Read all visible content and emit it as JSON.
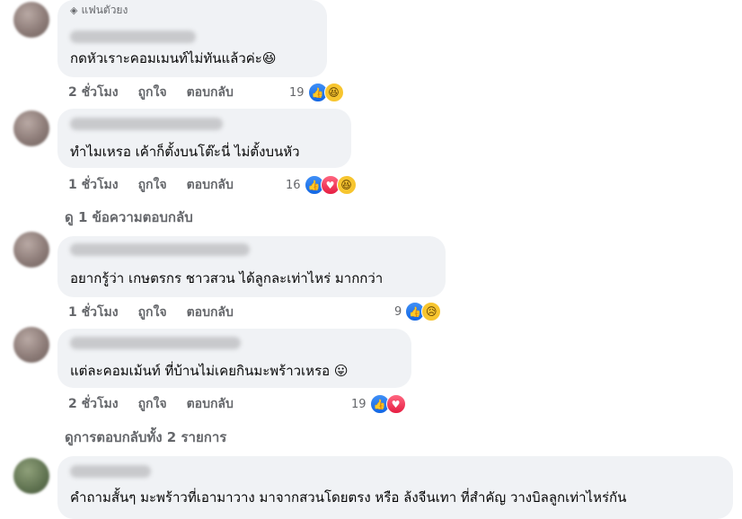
{
  "badge_label": "แฟนตัวยง",
  "comments": [
    {
      "text": "กดหัวเราะคอมเมนท์ไม่ทันแล้วค่ะ",
      "text_emoji": "😆",
      "time": "2 ชั่วโมง",
      "like_label": "ถูกใจ",
      "reply_label": "ตอบกลับ",
      "reaction_count": "19",
      "reactions": [
        "like-icon",
        "haha-icon"
      ]
    },
    {
      "text": "ทำไมเหรอ เค้าก็ตั้งบนโต๊ะนี่ ไม่ตั้งบนหัว",
      "text_emoji": "",
      "time": "1 ชั่วโมง",
      "like_label": "ถูกใจ",
      "reply_label": "ตอบกลับ",
      "reaction_count": "16",
      "reactions": [
        "like-icon",
        "love-icon",
        "haha-icon"
      ]
    },
    {
      "text": "อยากรู้ว่า เกษตรกร ชาวสวน ได้ลูกละเท่าไหร่ มากกว่า",
      "text_emoji": "",
      "time": "1 ชั่วโมง",
      "like_label": "ถูกใจ",
      "reply_label": "ตอบกลับ",
      "reaction_count": "9",
      "reactions": [
        "like-icon",
        "sad-icon"
      ]
    },
    {
      "text": "แต่ละคอมเม้นท์ ที่บ้านไม่เคยกินมะพร้าวเหรอ",
      "text_emoji": "😛",
      "time": "2 ชั่วโมง",
      "like_label": "ถูกใจ",
      "reply_label": "ตอบกลับ",
      "reaction_count": "19",
      "reactions": [
        "like-icon",
        "love-icon"
      ]
    },
    {
      "text": "คำถามสั้นๆ มะพร้าวที่เอามาวาง มาจากสวนโดยตรง หรือ ล้งจีนเทา ที่สำคัญ วางบิลลูกเท่าไหร่กัน",
      "text_emoji": "",
      "time": "",
      "like_label": "",
      "reply_label": "",
      "reaction_count": "",
      "reactions": []
    }
  ],
  "view_replies_1": "ดู 1 ข้อความตอบกลับ",
  "view_replies_all": "ดูการตอบกลับทั้ง 2 รายการ",
  "colors": {
    "bubble": "#f0f2f5",
    "meta_text": "#65676b",
    "like_blue": "#1877f2",
    "love_red": "#f33e58",
    "haha_yellow": "#f7c52f"
  }
}
